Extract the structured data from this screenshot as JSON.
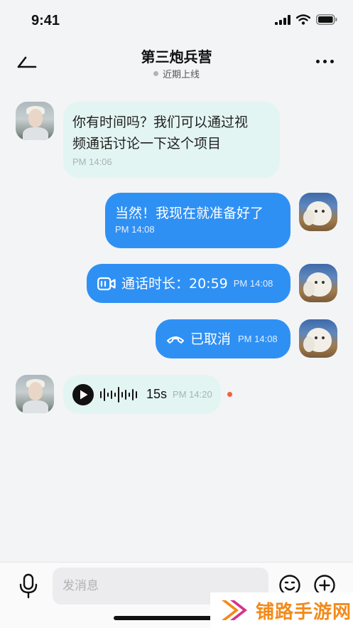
{
  "status_bar": {
    "time": "9:41"
  },
  "header": {
    "title": "第三炮兵营",
    "subtitle": "近期上线"
  },
  "messages": [
    {
      "side": "in",
      "type": "text",
      "text_line1": "你有时间吗？我们可以通过视",
      "text_line2": "频通话讨论一下这个项目",
      "time": "PM 14:06"
    },
    {
      "side": "out",
      "type": "text",
      "text": "当然！我现在就准备好了",
      "time": "PM 14:08"
    },
    {
      "side": "out",
      "type": "video_call",
      "text": "通话时长：20:59",
      "time": "PM 14:08"
    },
    {
      "side": "out",
      "type": "call_cancelled",
      "text": "已取消",
      "time": "PM 14:08"
    },
    {
      "side": "in",
      "type": "voice",
      "duration": "15s",
      "time": "PM 14:20",
      "unread": true
    }
  ],
  "composer": {
    "placeholder": "发消息"
  },
  "watermark": {
    "text": "铺路手游网"
  },
  "colors": {
    "incoming_bubble": "#e3f5f2",
    "outgoing_bubble": "#2f90f4",
    "unread_dot": "#f2603d",
    "watermark": "#f28a1a"
  }
}
